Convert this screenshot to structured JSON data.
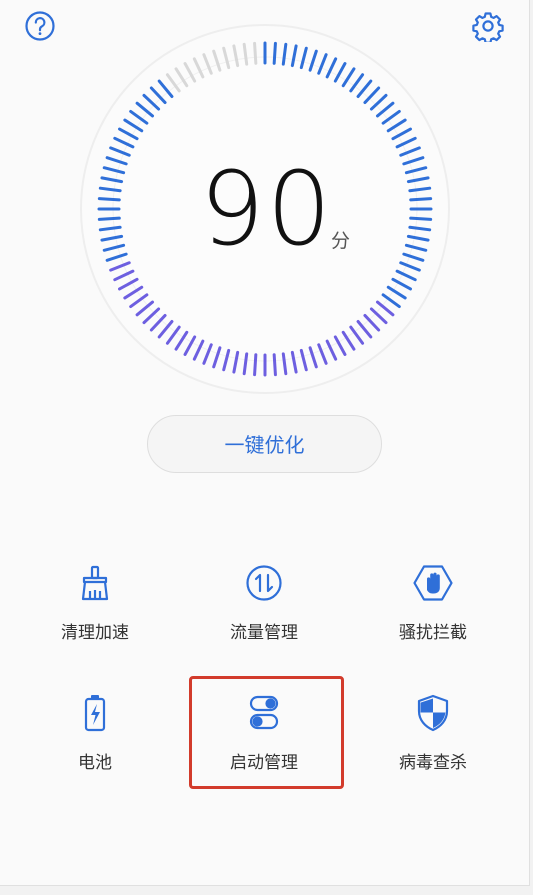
{
  "header": {
    "help_icon": "help-circle-icon",
    "settings_icon": "gear-icon"
  },
  "score": {
    "value": "90",
    "unit": "分",
    "progress": 0.9
  },
  "colors": {
    "accent": "#2f6fd8",
    "accent_light": "#6d5fe0",
    "tick_inactive": "#d8d8d8",
    "highlight": "#d23b2b"
  },
  "optimize_button": {
    "label": "一键优化"
  },
  "tools": [
    {
      "label": "清理加速",
      "icon": "broom-icon"
    },
    {
      "label": "流量管理",
      "icon": "data-traffic-icon"
    },
    {
      "label": "骚扰拦截",
      "icon": "block-hand-icon"
    },
    {
      "label": "电池",
      "icon": "battery-icon"
    },
    {
      "label": "启动管理",
      "icon": "toggle-switch-icon"
    },
    {
      "label": "病毒查杀",
      "icon": "shield-icon"
    }
  ]
}
